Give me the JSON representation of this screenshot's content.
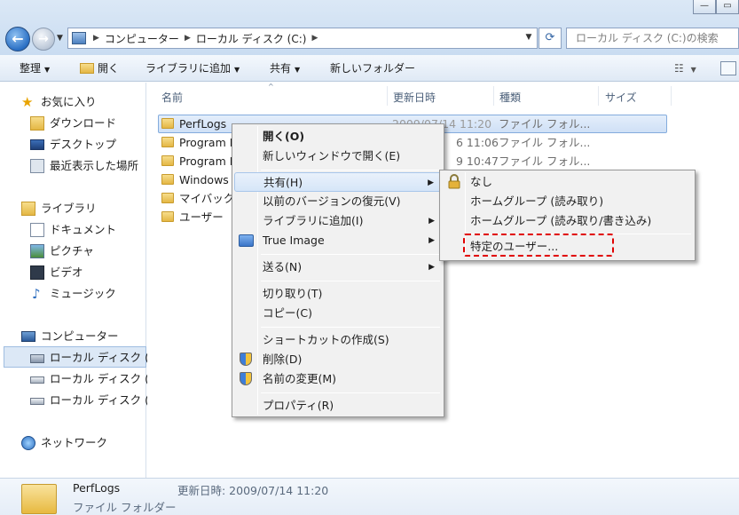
{
  "window": {
    "controls": [
      "—"
    ]
  },
  "address": {
    "crumbs": [
      "コンピューター",
      "ローカル ディスク (C:)"
    ],
    "search_placeholder": "ローカル ディスク (C:)の検索"
  },
  "toolbar": {
    "organize": "整理",
    "open": "開く",
    "add_to_library": "ライブラリに追加",
    "share": "共有",
    "new_folder": "新しいフォルダー"
  },
  "nav": {
    "favorites": "お気に入り",
    "downloads": "ダウンロード",
    "desktop": "デスクトップ",
    "recent": "最近表示した場所",
    "libraries": "ライブラリ",
    "documents": "ドキュメント",
    "pictures": "ピクチャ",
    "videos": "ビデオ",
    "music": "ミュージック",
    "computer": "コンピューター",
    "drives": [
      "ローカル ディスク (",
      "ローカル ディスク (",
      "ローカル ディスク ("
    ],
    "network": "ネットワーク"
  },
  "columns": {
    "name": "名前",
    "modified": "更新日時",
    "type": "種類",
    "size": "サイズ"
  },
  "files": [
    {
      "name": "PerfLogs",
      "modified": "2009/07/14 11:20",
      "type": "ファイル フォル..."
    },
    {
      "name": "Program F",
      "modified": "6 11:06",
      "type": "ファイル フォル..."
    },
    {
      "name": "Program F",
      "modified": "9 10:47",
      "type": "ファイル フォル..."
    },
    {
      "name": "Windows",
      "modified": "",
      "type": "ファイル フォル..."
    },
    {
      "name": "マイバック",
      "modified": "",
      "type": "ファイル フォル..."
    },
    {
      "name": "ユーザー",
      "modified": "",
      "type": "ファイル フォル..."
    }
  ],
  "context_menu": {
    "open": "開く(O)",
    "open_new_window": "新しいウィンドウで開く(E)",
    "share": "共有(H)",
    "restore_versions": "以前のバージョンの復元(V)",
    "include_library": "ライブラリに追加(I)",
    "true_image": "True Image",
    "send_to": "送る(N)",
    "cut": "切り取り(T)",
    "copy": "コピー(C)",
    "create_shortcut": "ショートカットの作成(S)",
    "delete": "削除(D)",
    "rename": "名前の変更(M)",
    "properties": "プロパティ(R)"
  },
  "share_submenu": {
    "nobody": "なし",
    "homegroup_read": "ホームグループ (読み取り)",
    "homegroup_readwrite": "ホームグループ (読み取り/書き込み)",
    "specific_people": "特定のユーザー..."
  },
  "details": {
    "name": "PerfLogs",
    "modified_label": "更新日時: 2009/07/14 11:20",
    "type": "ファイル フォルダー"
  },
  "colors": {
    "highlight": "#cfe0f6",
    "annotation": "#e00000"
  }
}
